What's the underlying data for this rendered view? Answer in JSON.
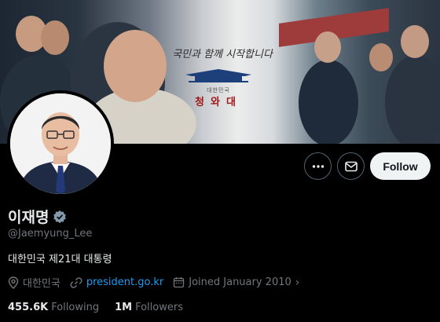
{
  "banner": {
    "slogan": "국민과 함께 시작합니다",
    "building_sub": "대한민국",
    "building_name": "청와대"
  },
  "actions": {
    "more_icon": "more-horizontal-icon",
    "message_icon": "mail-icon",
    "follow_label": "Follow"
  },
  "profile": {
    "display_name": "이재명",
    "verified": true,
    "handle": "@Jaemyung_Lee",
    "bio": "대한민국 제21대 대통령",
    "location": "대한민국",
    "website": "president.go.kr",
    "joined": "Joined January 2010"
  },
  "stats": {
    "following_count": "455.6K",
    "following_label": "Following",
    "followers_count": "1M",
    "followers_label": "Followers"
  },
  "colors": {
    "background": "#000000",
    "link": "#1d9bf0",
    "muted": "#71767b",
    "verified_badge": "#829aab",
    "follow_button_bg": "#eff3f4"
  }
}
